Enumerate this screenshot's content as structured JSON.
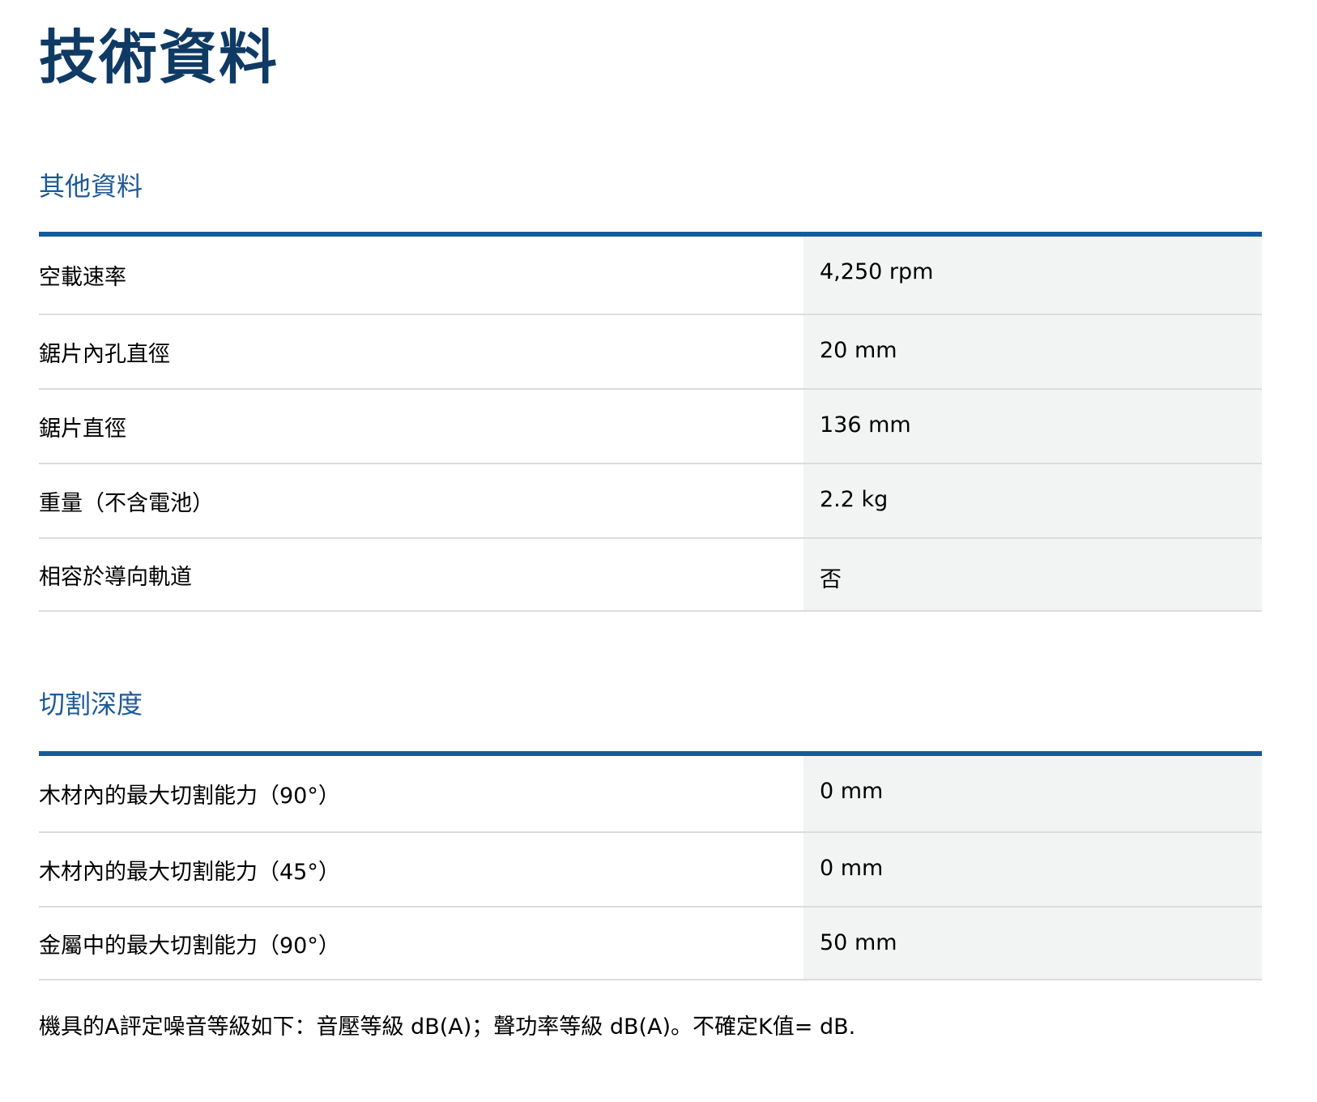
{
  "page_title": "技術資料",
  "colors": {
    "title": "#0f3a64",
    "section_title": "#1e5a96",
    "rule": "#155b9a",
    "value_bg": "#f2f4f4",
    "row_divider": "#dcdcdc"
  },
  "sections": [
    {
      "title": "其他資料",
      "rows": [
        {
          "label": "空載速率",
          "value": "4,250 rpm"
        },
        {
          "label": "鋸片內孔直徑",
          "value": "20 mm"
        },
        {
          "label": "鋸片直徑",
          "value": "136 mm"
        },
        {
          "label": "重量（不含電池）",
          "value": "2.2 kg"
        },
        {
          "label": "相容於導向軌道",
          "value": "否"
        }
      ]
    },
    {
      "title": "切割深度",
      "rows": [
        {
          "label": "木材內的最大切割能力（90°）",
          "value": "0 mm"
        },
        {
          "label": "木材內的最大切割能力（45°）",
          "value": "0 mm"
        },
        {
          "label": "金屬中的最大切割能力（90°）",
          "value": "50 mm"
        }
      ]
    }
  ],
  "footnote": "機具的A評定噪音等級如下：音壓等級 dB(A)；聲功率等級 dB(A)。不確定K值= dB."
}
